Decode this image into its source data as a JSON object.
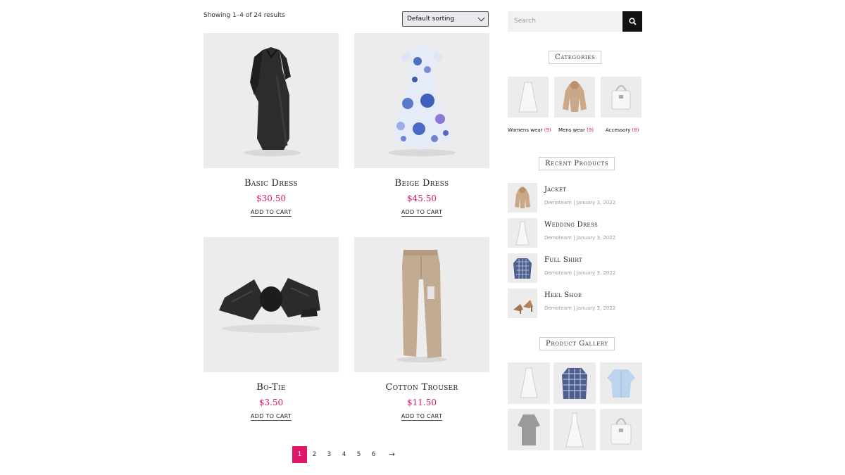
{
  "shop": {
    "result_count": "Showing 1–4 of 24 results",
    "sort_selected": "Default sorting"
  },
  "products": [
    {
      "title": "Basic Dress",
      "price": "$30.50",
      "cart": "ADD TO CART",
      "icon": "black-dress-image"
    },
    {
      "title": "Beige Dress",
      "price": "$45.50",
      "cart": "ADD TO CART",
      "icon": "polka-dot-dress-image"
    },
    {
      "title": "Bo-Tie",
      "price": "$3.50",
      "cart": "ADD TO CART",
      "icon": "bow-tie-image"
    },
    {
      "title": "Cotton Trouser",
      "price": "$11.50",
      "cart": "ADD TO CART",
      "icon": "trouser-image"
    }
  ],
  "pagination": {
    "pages": [
      "1",
      "2",
      "3",
      "4",
      "5",
      "6"
    ],
    "next": "→",
    "current": "1"
  },
  "sidebar": {
    "search_placeholder": "Search",
    "categories_title": "Categories",
    "categories": [
      {
        "label": "Womens wear",
        "count": "(9)"
      },
      {
        "label": "Mens wear",
        "count": "(9)"
      },
      {
        "label": "Accessory",
        "count": "(8)"
      }
    ],
    "recent_title": "Recent Products",
    "recent": [
      {
        "title": "Jacket",
        "author": "Demoteam",
        "date": "January 3, 2022"
      },
      {
        "title": "Wedding Dress",
        "author": "Demoteam",
        "date": "January 3, 2022"
      },
      {
        "title": "Full Shirt",
        "author": "Demoteam",
        "date": "January 3, 2022"
      },
      {
        "title": "Heel Shoe",
        "author": "Demoteam",
        "date": "January 3, 2022"
      }
    ],
    "gallery_title": "Product Gallery"
  },
  "colors": {
    "accent": "#e0186b",
    "price": "#d6196a",
    "image_bg": "#ececec"
  }
}
